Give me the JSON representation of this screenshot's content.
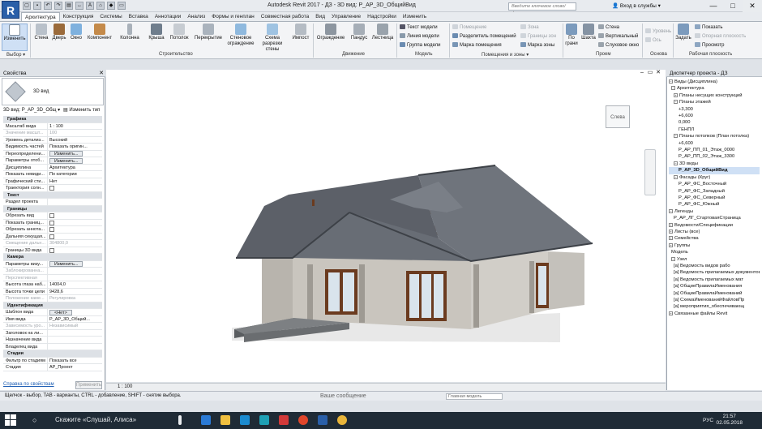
{
  "app": {
    "logo": "R",
    "window_title": "Autodesk Revit 2017 -   ДЗ - 3D вид: Р_АР_3D_ОбщийВид",
    "search_placeholder": "Введите ключевое слово/фразу",
    "login": "Вход в службы",
    "controls": {
      "minimize": "—",
      "maximize": "□",
      "close": "✕"
    }
  },
  "ribbon": {
    "tabs": [
      "Архитектура",
      "Конструкция",
      "Системы",
      "Вставка",
      "Аннотации",
      "Анализ",
      "Формы и генплан",
      "Совместная работа",
      "Вид",
      "Управление",
      "Надстройки",
      "Изменить"
    ],
    "active_tab": "Архитектура",
    "buttons": {
      "modify": "Изменить",
      "wall": "Стена",
      "door": "Дверь",
      "window": "Окно",
      "component": "Компонент",
      "column": "Колонна",
      "roof": "Крыша",
      "ceiling": "Потолок",
      "floor": "Перекрытие",
      "curtain_system": "Стеновое ограждение",
      "curtain_grid": "Схема разрезки стены",
      "mullion": "Импост",
      "railing": "Ограждение",
      "ramp": "Пандус",
      "stair": "Лестница",
      "model_text": "Текст модели",
      "model_line": "Линия модели",
      "model_group": "Группа модели",
      "room": "Помещение",
      "room_separator": "Разделитель помещений",
      "room_tag": "Марка помещения",
      "area": "Зона",
      "area_boundary": "Границы зон",
      "area_tag": "Марка зоны",
      "by_face": "По грани",
      "shaft": "Шахта",
      "wall_opening": "Стена",
      "vertical": "Вертикальный",
      "dormer": "Слуховое окно",
      "level": "Уровень",
      "grid": "Ось",
      "set": "Задать",
      "show": "Показать",
      "ref_plane": "Опорная плоскость",
      "viewer": "Просмотр"
    },
    "groups": {
      "select": "Выбор ▾",
      "build": "Строительство",
      "circulation": "Движение",
      "model": "Модель",
      "room_area": "Помещения и зоны ▾",
      "opening": "Проем",
      "datum": "Основа",
      "work_plane": "Рабочая плоскость"
    }
  },
  "properties": {
    "title": "Свойства",
    "close": "✕",
    "type_name": "3D вид",
    "view_selector": "3D вид: Р_АР_3D_Общ ▾",
    "edit_type": "Изменить тип",
    "rows": [
      {
        "sec": "Графика"
      },
      {
        "k": "Масштаб вида",
        "v": "1 : 100"
      },
      {
        "k": "Значение масшт...",
        "v": "100",
        "dim": true
      },
      {
        "k": "Уровень детализ...",
        "v": "Высокий"
      },
      {
        "k": "Видимость частей",
        "v": "Показать оригин..."
      },
      {
        "k": "Переопределени...",
        "btn": "Изменить..."
      },
      {
        "k": "Параметры отоб...",
        "btn": "Изменить..."
      },
      {
        "k": "Дисциплина",
        "v": "Архитектура"
      },
      {
        "k": "Показать невиди...",
        "v": "По категории"
      },
      {
        "k": "Графический сти...",
        "v": "Нет"
      },
      {
        "k": "Траектория солн...",
        "chk": true
      },
      {
        "sec": "Текст"
      },
      {
        "k": "Раздел проекта",
        "v": ""
      },
      {
        "sec": "Границы"
      },
      {
        "k": "Обрезать вид",
        "chk": true
      },
      {
        "k": "Показать границ...",
        "chk": true
      },
      {
        "k": "Обрезать аннота...",
        "chk": true
      },
      {
        "k": "Дальняя секущая...",
        "chk": true
      },
      {
        "k": "Смещение дальн...",
        "v": "304800,0",
        "dim": true
      },
      {
        "k": "Границы 3D вида",
        "chk": true
      },
      {
        "sec": "Камера"
      },
      {
        "k": "Параметры визу...",
        "btn": "Изменить..."
      },
      {
        "k": "Заблокированна...",
        "v": "",
        "dim": true
      },
      {
        "k": "Перспективная",
        "v": "",
        "dim": true
      },
      {
        "k": "Высота глаза наб...",
        "v": "14004,0"
      },
      {
        "k": "Высота точки цели",
        "v": "9428,6"
      },
      {
        "k": "Положение каме...",
        "v": "Регулировка",
        "dim": true
      },
      {
        "sec": "Идентификация"
      },
      {
        "k": "Шаблон вида",
        "btn": "<Нет>"
      },
      {
        "k": "Имя вида",
        "v": "Р_АР_3D_Общий..."
      },
      {
        "k": "Зависимость уро...",
        "v": "Независимый",
        "dim": true
      },
      {
        "k": "Заголовок на ли...",
        "v": ""
      },
      {
        "k": "Назначение вида",
        "v": ""
      },
      {
        "k": "Владелец вида",
        "v": ""
      },
      {
        "sec": "Стадии"
      },
      {
        "k": "Фильтр по стадиям",
        "v": "Показать все"
      },
      {
        "k": "Стадия",
        "v": "АР_Проект"
      }
    ],
    "help_link": "Справка по свойствам",
    "apply": "Применить"
  },
  "viewport": {
    "viewcube_label": "Слева",
    "scale": "1 : 100"
  },
  "project_browser": {
    "title": "Диспетчер проекта - ДЗ",
    "nodes": [
      {
        "t": "Виды (Дисциплина)",
        "d": 0,
        "exp": "−"
      },
      {
        "t": "Архитектура",
        "d": 1,
        "exp": "−"
      },
      {
        "t": "Планы несущих конструкций",
        "d": 2,
        "exp": "+"
      },
      {
        "t": "Планы этажей",
        "d": 2,
        "exp": "−"
      },
      {
        "t": "+3,300",
        "d": 4
      },
      {
        "t": "+6,600",
        "d": 4
      },
      {
        "t": "0,000",
        "d": 4
      },
      {
        "t": "ГЕНПЛ",
        "d": 4
      },
      {
        "t": "Планы потолков (План потолка)",
        "d": 2,
        "exp": "−"
      },
      {
        "t": "+6,600",
        "d": 4
      },
      {
        "t": "Р_АР_ПП_01_Этаж_0000",
        "d": 4
      },
      {
        "t": "Р_АР_ПП_02_Этаж_3300",
        "d": 4
      },
      {
        "t": "3D виды",
        "d": 2,
        "exp": "−"
      },
      {
        "t": "Р_АР_3D_ОбщийВид",
        "d": 4,
        "sel": true
      },
      {
        "t": "Фасады (Круг)",
        "d": 2,
        "exp": "−"
      },
      {
        "t": "Р_АР_ФС_Восточный",
        "d": 4
      },
      {
        "t": "Р_АР_ФС_Западный",
        "d": 4
      },
      {
        "t": "Р_АР_ФС_Северный",
        "d": 4
      },
      {
        "t": "Р_АР_ФС_Южный",
        "d": 4
      },
      {
        "t": "Легенды",
        "d": 0,
        "exp": "−"
      },
      {
        "t": "Р_АР_ЛГ_СтартоваяСтраница",
        "d": 2
      },
      {
        "t": "Ведомости/Спецификации",
        "d": 0,
        "exp": "+"
      },
      {
        "t": "Листы (все)",
        "d": 0,
        "exp": "+"
      },
      {
        "t": "Семейства",
        "d": 0,
        "exp": "+"
      },
      {
        "t": "Группы",
        "d": 0,
        "exp": "+"
      },
      {
        "t": "Модель",
        "d": 1
      },
      {
        "t": "Узел",
        "d": 1,
        "exp": "−"
      },
      {
        "t": "[a] Ведомость видов рабо",
        "d": 2
      },
      {
        "t": "[a] Ведомость прилагаемых документов",
        "d": 2
      },
      {
        "t": "[a] Ведомость прилагаемых мат",
        "d": 2
      },
      {
        "t": "[a] ОбщиеПравилаИменования",
        "d": 2
      },
      {
        "t": "[a] ОбщиеПравилаИменований",
        "d": 2
      },
      {
        "t": "[a] СхемаИменованийФайловПр",
        "d": 2
      },
      {
        "t": "[a] мероприятия_обеспечивающ",
        "d": 2
      },
      {
        "t": "Связанные файлы Revit",
        "d": 0,
        "exp": "+"
      }
    ]
  },
  "statusbar": {
    "hint": "Щелчок - выбор, TAB - варианты, CTRL - добавление, SHIFT - снятие выбора.",
    "chat": "Ваше сообщение",
    "model": "Главная модель"
  },
  "taskbar": {
    "search": "Скажите «Слушай, Алиса»",
    "lang": "РУС",
    "time": "21:57",
    "date": "02.05.2018"
  }
}
